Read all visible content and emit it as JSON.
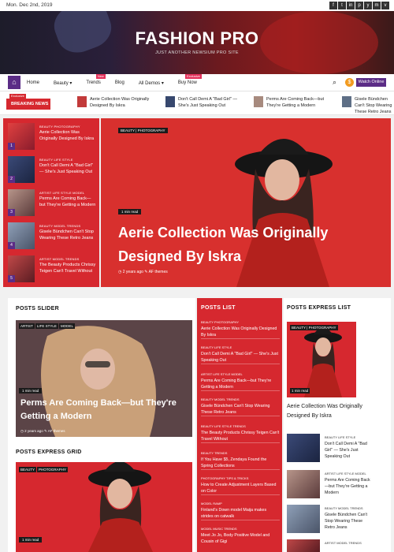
{
  "topbar": {
    "date": "Mon. Dec 2nd, 2019",
    "social": [
      "f",
      "t",
      "in",
      "p",
      "y",
      "m",
      "v"
    ]
  },
  "header": {
    "title": "FASHION PRO",
    "tagline": "JUST ANOTHER NEWSIUM PRO SITE"
  },
  "nav": {
    "items": [
      {
        "label": "Home"
      },
      {
        "label": "Beauty ▾"
      },
      {
        "label": "Trends",
        "badge": "New",
        "badge_color": "#e3315b"
      },
      {
        "label": "Blog"
      },
      {
        "label": "All Demos ▾"
      },
      {
        "label": "Buy Now",
        "badge": "Exclusive",
        "badge_color": "#e3315b"
      }
    ],
    "watch_label": "Watch Online"
  },
  "breaking": {
    "tag": "Exclusive",
    "label": "BREAKING NEWS",
    "items": [
      "Aerie Collection Was Originally Designed By Iskra",
      "Don't Call Demi A \"Bad Girl\" — She's Just Speaking Out",
      "Perms Are Coming Back—but They're Getting a Modern",
      "Gisele Bündchen Can't Stop Wearing These Retro Jeans"
    ]
  },
  "hero_list": [
    {
      "num": "1",
      "cats": "BEAUTY  PHOTOGRAPHY",
      "title": "Aerie Collection Was Originally Designed By Iskra"
    },
    {
      "num": "2",
      "cats": "BEAUTY  LIFE STYLE",
      "title": "Don't Call Demi A \"Bad Girl\" — She's Just Speaking Out"
    },
    {
      "num": "3",
      "cats": "ARTIST  LIFE STYLE  MODEL",
      "title": "Perms Are Coming Back—but They're Getting a Modern"
    },
    {
      "num": "4",
      "cats": "BEAUTY  MODEL  TRENDS",
      "title": "Gisele Bündchen Can't Stop Wearing These Retro Jeans"
    },
    {
      "num": "5",
      "cats": "ARTIST  MODEL  TRENDS",
      "title": "The Beauty Products Chrissy Teigen Can't Travel Without"
    }
  ],
  "hero_main": {
    "cats": "BEAUTY | PHOTOGRAPHY",
    "time": "1 min read",
    "title": "Aerie Collection Was Originally Designed By Iskra",
    "meta": "◷ 2 years ago   ✎ AF themes"
  },
  "posts_slider": {
    "heading": "POSTS SLIDER",
    "tags": [
      "ARTIST",
      "LIFE STYLE",
      "MODEL"
    ],
    "time": "1 min read",
    "title": "Perms Are Coming Back—but They're Getting a Modern",
    "meta": "◷ 2 years ago   ✎ AF themes"
  },
  "posts_grid": {
    "heading": "POSTS EXPRESS GRID",
    "tags": [
      "BEAUTY",
      "PHOTOGRAPHY"
    ],
    "time": "1 min read"
  },
  "posts_list": {
    "heading": "POSTS LIST",
    "items": [
      {
        "cats": "BEAUTY  PHOTOGRAPHY",
        "title": "Aerie Collection Was Originally Designed By Iskra"
      },
      {
        "cats": "BEAUTY  LIFE STYLE",
        "title": "Don't Call Demi A \"Bad Girl\" — She's Just Speaking Out"
      },
      {
        "cats": "ARTIST  LIFE STYLE  MODEL",
        "title": "Perms Are Coming Back—but They're Getting a Modern"
      },
      {
        "cats": "BEAUTY  MODEL  TRENDS",
        "title": "Gisele Bündchen Can't Stop Wearing These Retro Jeans"
      },
      {
        "cats": "BEAUTY  LIFE STYLE  TRENDS",
        "title": "The Beauty Products Chrissy Teigen Can't Travel Without"
      },
      {
        "cats": "BEAUTY  TRENDS",
        "title": "If You Have $5, Zendaya Found the Spring Collections"
      },
      {
        "cats": "PHOTOGRAPHY  TIPS & TRICKS",
        "title": "How to Create Adjustment Layers Based on Color"
      },
      {
        "cats": "MODEL  RAMP",
        "title": "Finland's Down model Maija makes strides on catwalk"
      },
      {
        "cats": "MODEL  MUSIC  TRENDS",
        "title": "Meet Jo Jo, Body Positive Model and Cousin of Gigi"
      }
    ]
  },
  "posts_express": {
    "heading": "POSTS EXPRESS LIST",
    "tags": "BEAUTY | PHOTOGRAPHY",
    "time": "1 min read",
    "title": "Aerie Collection Was Originally Designed By Iskra",
    "items": [
      {
        "cats": "BEAUTY  LIFE STYLE",
        "title": "Don't Call Demi A \"Bad Girl\" — She's Just Speaking Out"
      },
      {
        "cats": "ARTIST  LIFE STYLE  MODEL",
        "title": "Perms Are Coming Back—but They're Getting a Modern"
      },
      {
        "cats": "BEAUTY  MODEL  TRENDS",
        "title": "Gisele Bündchen Can't Stop Wearing These Retro Jeans"
      },
      {
        "cats": "ARTIST  MODEL  TRENDS",
        "title": ""
      }
    ]
  },
  "colors": {
    "accent": "#d6282f",
    "brand": "#5b2c86"
  }
}
